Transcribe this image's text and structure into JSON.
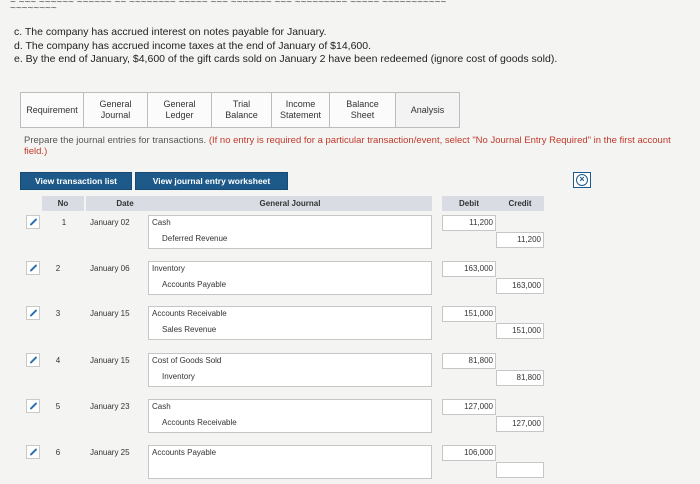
{
  "notes": {
    "c": "c. The company has accrued interest on notes payable for January.",
    "d": "d. The company has accrued income taxes at the end of January of $14,600.",
    "e": "e. By the end of January, $4,600 of the gift cards sold on January 2 have been redeemed (ignore cost of goods sold)."
  },
  "tabs": [
    {
      "label": "Requirement"
    },
    {
      "label": "General Journal"
    },
    {
      "label": "General Ledger"
    },
    {
      "label": "Trial Balance"
    },
    {
      "label": "Income Statement"
    },
    {
      "label": "Balance Sheet"
    },
    {
      "label": "Analysis"
    }
  ],
  "instruction": {
    "text": "Prepare the journal entries for transactions.",
    "emphasis": "(If no entry is required for a particular transaction/event, select \"No Journal Entry Required\" in the first account field.)"
  },
  "buttons": {
    "view_transactions": "View transaction list",
    "view_worksheet": "View journal entry worksheet"
  },
  "table": {
    "headers": {
      "no": "No",
      "date": "Date",
      "journal": "General Journal",
      "debit": "Debit",
      "credit": "Credit"
    },
    "entries": [
      {
        "no": "1",
        "date": "January 02",
        "debit_account": "Cash",
        "credit_account": "Deferred Revenue",
        "debit": "11,200",
        "credit": "11,200"
      },
      {
        "no": "2",
        "date": "January 06",
        "debit_account": "Inventory",
        "credit_account": "Accounts Payable",
        "debit": "163,000",
        "credit": "163,000"
      },
      {
        "no": "3",
        "date": "January 15",
        "debit_account": "Accounts Receivable",
        "credit_account": "Sales Revenue",
        "debit": "151,000",
        "credit": "151,000"
      },
      {
        "no": "4",
        "date": "January 15",
        "debit_account": "Cost of Goods Sold",
        "credit_account": "Inventory",
        "debit": "81,800",
        "credit": "81,800"
      },
      {
        "no": "5",
        "date": "January 23",
        "debit_account": "Cash",
        "credit_account": "Accounts Receivable",
        "debit": "127,000",
        "credit": "127,000"
      },
      {
        "no": "6",
        "date": "January 25",
        "debit_account": "Accounts Payable",
        "credit_account": "",
        "debit": "106,000",
        "credit": ""
      }
    ]
  }
}
